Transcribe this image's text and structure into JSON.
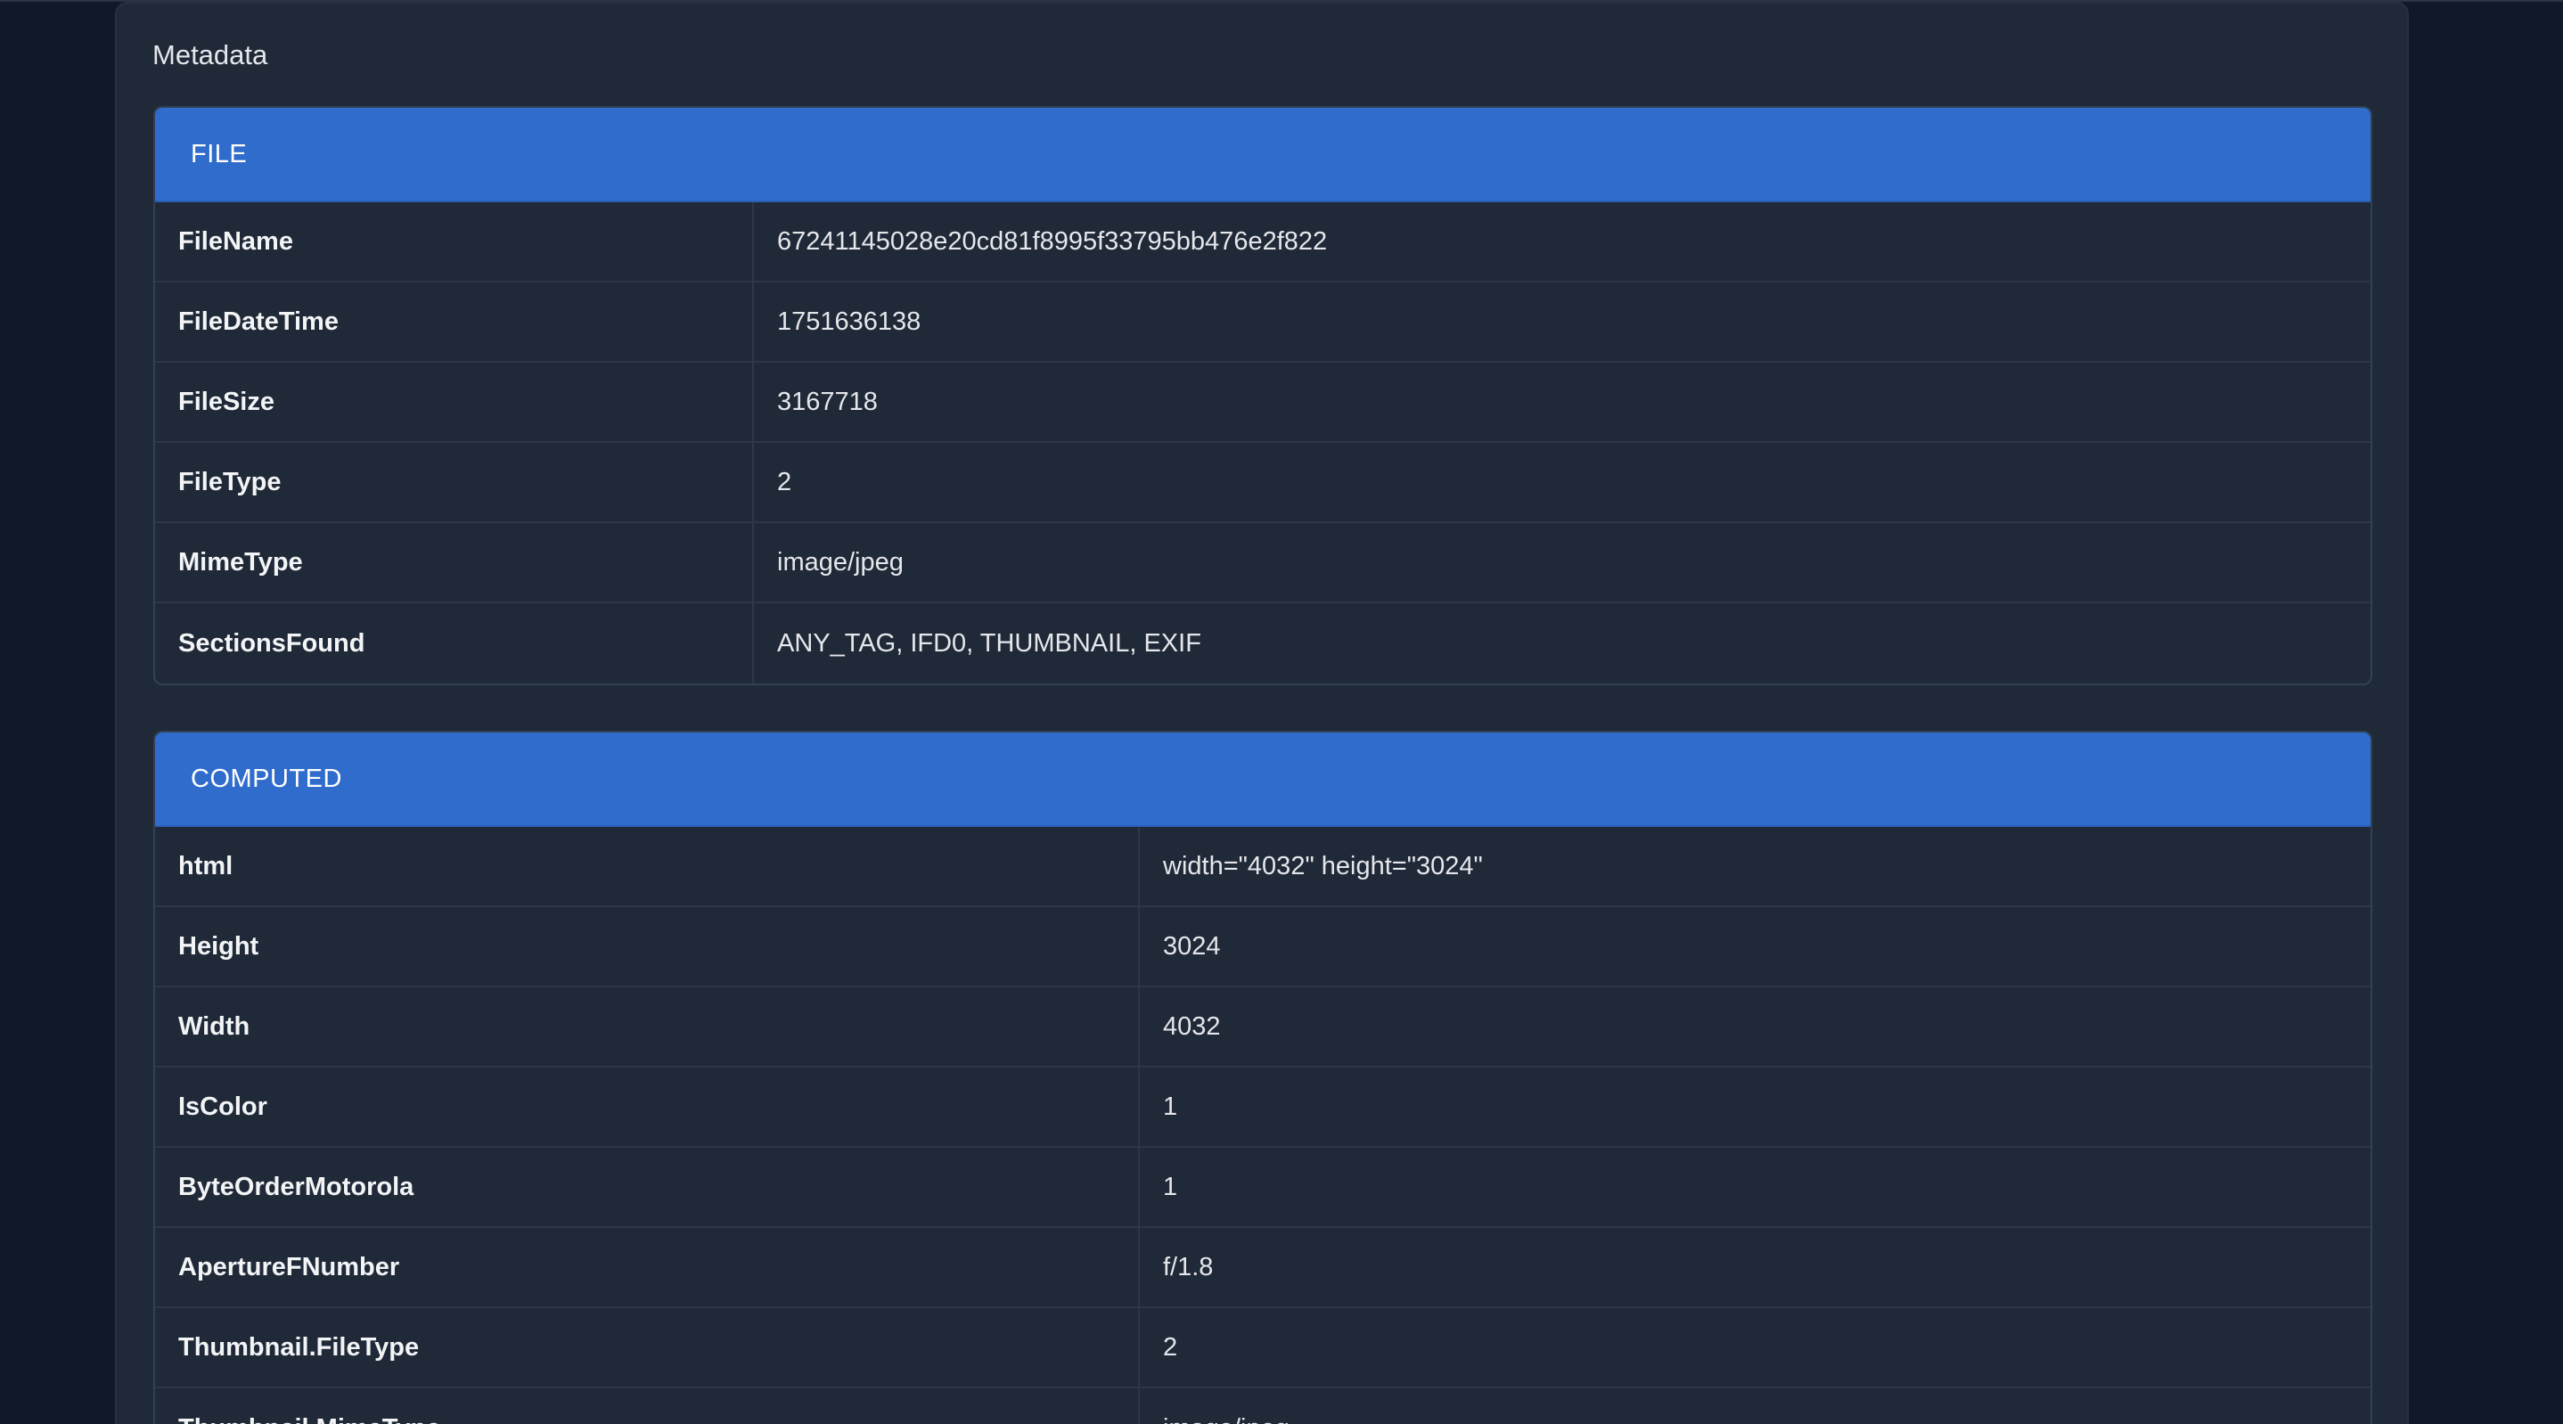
{
  "card": {
    "title": "Metadata"
  },
  "sections": {
    "file": {
      "label": "FILE",
      "rows": [
        {
          "key": "FileName",
          "value": "67241145028e20cd81f8995f33795bb476e2f822"
        },
        {
          "key": "FileDateTime",
          "value": "1751636138"
        },
        {
          "key": "FileSize",
          "value": "3167718"
        },
        {
          "key": "FileType",
          "value": "2"
        },
        {
          "key": "MimeType",
          "value": "image/jpeg"
        },
        {
          "key": "SectionsFound",
          "value": "ANY_TAG, IFD0, THUMBNAIL, EXIF"
        }
      ]
    },
    "computed": {
      "label": "COMPUTED",
      "rows": [
        {
          "key": "html",
          "value": "width=\"4032\" height=\"3024\""
        },
        {
          "key": "Height",
          "value": "3024"
        },
        {
          "key": "Width",
          "value": "4032"
        },
        {
          "key": "IsColor",
          "value": "1"
        },
        {
          "key": "ByteOrderMotorola",
          "value": "1"
        },
        {
          "key": "ApertureFNumber",
          "value": "f/1.8"
        },
        {
          "key": "Thumbnail.FileType",
          "value": "2"
        },
        {
          "key": "Thumbnail.MimeType",
          "value": "image/jpeg"
        }
      ]
    }
  }
}
